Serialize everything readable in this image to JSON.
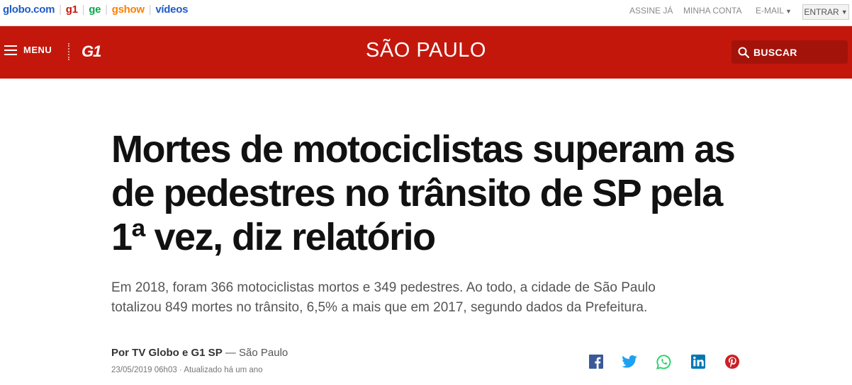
{
  "topbar": {
    "brands": [
      {
        "label": "globo.com"
      },
      {
        "label": "g1"
      },
      {
        "label": "ge"
      },
      {
        "label": "gshow"
      },
      {
        "label": "vídeos"
      }
    ],
    "assine": "ASSINE JÁ",
    "minha_conta": "MINHA CONTA",
    "email": "E-MAIL",
    "entrar": "ENTRAR"
  },
  "header": {
    "menu_label": "MENU",
    "logo": "G1",
    "section": "SÃO PAULO",
    "search_label": "BUSCAR"
  },
  "article": {
    "headline": "Mortes de motociclistas superam as de pedestres no trânsito de SP pela 1ª vez, diz relatório",
    "subhead": "Em 2018, foram 366 motociclistas mortos e 349 pedestres. Ao todo, a cidade de São Paulo totalizou 849 mortes no trânsito, 6,5% a mais que em 2017, segundo dados da Prefeitura.",
    "author": "Por TV Globo e G1 SP",
    "location": " — São Paulo",
    "date": "23/05/2019 06h03",
    "updated": " · Atualizado há um ano"
  },
  "colors": {
    "brand_red": "#c4170c",
    "search_bg": "#a3130a",
    "facebook": "#3b5998",
    "twitter": "#1da1f2",
    "whatsapp": "#25d366",
    "linkedin": "#0077b5",
    "pinterest": "#cb2027"
  },
  "share_icons": [
    "facebook-icon",
    "twitter-icon",
    "whatsapp-icon",
    "linkedin-icon",
    "pinterest-icon"
  ]
}
